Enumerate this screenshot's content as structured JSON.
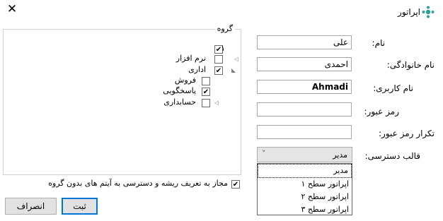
{
  "window": {
    "title": "اپراتور",
    "close_glyph": "✕",
    "app_icon": "operator-icon"
  },
  "form": {
    "first_name": {
      "label": "نام:",
      "value": "علی"
    },
    "last_name": {
      "label": "نام خانوادگی:",
      "value": "احمدی"
    },
    "username": {
      "label": "نام کاربری:",
      "value": "Ahmadi"
    },
    "password": {
      "label": "رمز عبور:",
      "value": ""
    },
    "password_repeat": {
      "label": "تکرار رمز عبور:",
      "value": ""
    },
    "access_template": {
      "label": "قالب دسترسی:",
      "selected": "مدیر",
      "arrow": "˅",
      "options": [
        "مدیر",
        "اپراتور سطح ۱",
        "اپراتور سطح ۲",
        "اپراتور سطح ۳"
      ]
    }
  },
  "group_box": {
    "legend": "گروه",
    "tree": [
      {
        "label": "۱",
        "checked": true
      },
      {
        "label": "نرم افزار",
        "checked": false
      },
      {
        "label": "اداری",
        "checked": true
      },
      {
        "label": "فروش",
        "checked": false
      },
      {
        "label": "پاسخگویی",
        "checked": true
      },
      {
        "label": "حسابداری",
        "checked": false
      }
    ]
  },
  "allow_root": {
    "label": "مجاز به تعریف ریشه و دسترسی به آیتم های بدون گروه",
    "checked": true
  },
  "buttons": {
    "submit": "ثبت",
    "cancel": "انصراف"
  }
}
